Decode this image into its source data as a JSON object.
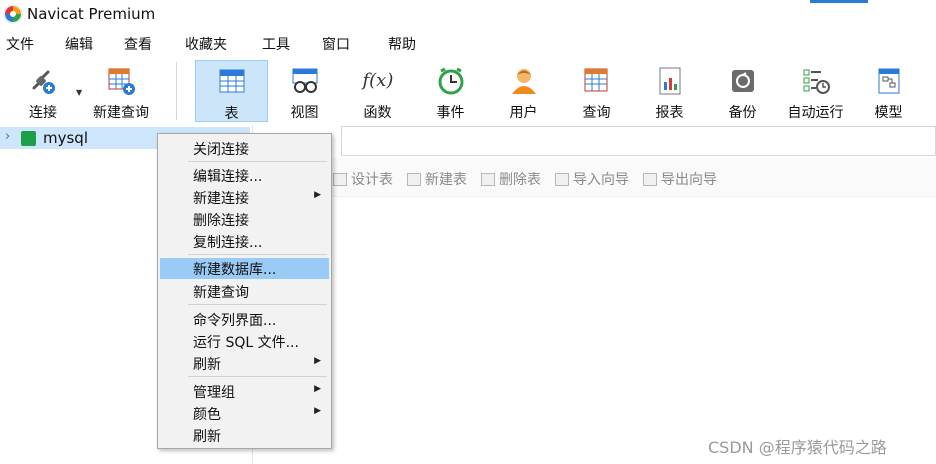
{
  "app": {
    "title": "Navicat Premium"
  },
  "menubar": [
    "文件",
    "编辑",
    "查看",
    "收藏夹",
    "工具",
    "窗口",
    "帮助"
  ],
  "toolbar": {
    "connect": "连接",
    "new_query": "新建查询",
    "table": "表",
    "view": "视图",
    "function": "函数",
    "event": "事件",
    "user": "用户",
    "query": "查询",
    "report": "报表",
    "backup": "备份",
    "automation": "自动运行",
    "model": "模型",
    "function_glyph": "f(x)"
  },
  "sidebar": {
    "connection": "mysql"
  },
  "object_toolbar": [
    "设计表",
    "新建表",
    "删除表",
    "导入向导",
    "导出向导"
  ],
  "context_menu": [
    {
      "label": "关闭连接",
      "submenu": false
    },
    {
      "label": "编辑连接...",
      "submenu": false
    },
    {
      "label": "新建连接",
      "submenu": true
    },
    {
      "label": "删除连接",
      "submenu": false
    },
    {
      "label": "复制连接...",
      "submenu": false
    },
    {
      "label": "新建数据库...",
      "submenu": false,
      "highlighted": true
    },
    {
      "label": "新建查询",
      "submenu": false
    },
    {
      "label": "命令列界面...",
      "submenu": false
    },
    {
      "label": "运行 SQL 文件...",
      "submenu": false
    },
    {
      "label": "刷新",
      "submenu": true
    },
    {
      "label": "管理组",
      "submenu": true
    },
    {
      "label": "颜色",
      "submenu": true
    },
    {
      "label": "刷新",
      "submenu": false
    }
  ],
  "watermark": "CSDN @程序猿代码之路",
  "colors": {
    "accent": "#2a7ad8",
    "selection": "#cde6fb",
    "menu_highlight": "#99cbf6",
    "active_tool": "#cce5f8"
  }
}
